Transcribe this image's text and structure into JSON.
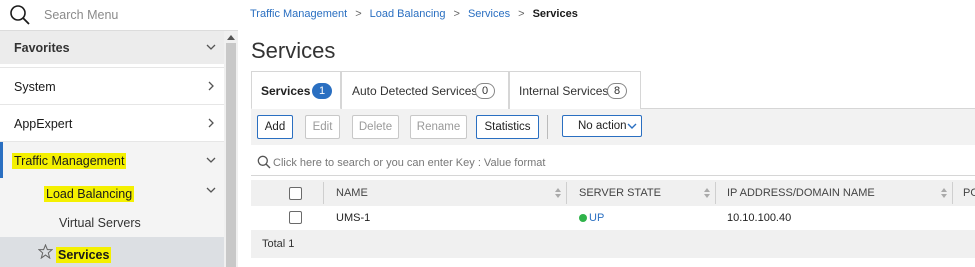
{
  "sidebar": {
    "search_placeholder": "Search Menu",
    "favorites": "Favorites",
    "system": "System",
    "appexpert": "AppExpert",
    "traffic_management": "Traffic Management",
    "load_balancing": "Load Balancing",
    "virtual_servers": "Virtual Servers",
    "services": "Services"
  },
  "breadcrumb": {
    "items": [
      "Traffic Management",
      "Load Balancing",
      "Services"
    ],
    "current": "Services"
  },
  "page": {
    "title": "Services"
  },
  "tabs": [
    {
      "label": "Services",
      "count": "1"
    },
    {
      "label": "Auto Detected Services",
      "count": "0"
    },
    {
      "label": "Internal Services",
      "count": "8"
    }
  ],
  "toolbar": {
    "add": "Add",
    "edit": "Edit",
    "delete": "Delete",
    "rename": "Rename",
    "statistics": "Statistics",
    "action_select": "No action"
  },
  "search": {
    "placeholder": "Click here to search or you can enter Key : Value format"
  },
  "table": {
    "columns": [
      "NAME",
      "SERVER STATE",
      "IP ADDRESS/DOMAIN NAME",
      "PO"
    ],
    "rows": [
      {
        "name": "UMS-1",
        "state": "UP",
        "ip": "10.10.100.40"
      }
    ],
    "total": "Total 1"
  },
  "colors": {
    "accent": "#2a6fc1",
    "highlight": "#f4f000",
    "status_up": "#2fb34a"
  }
}
